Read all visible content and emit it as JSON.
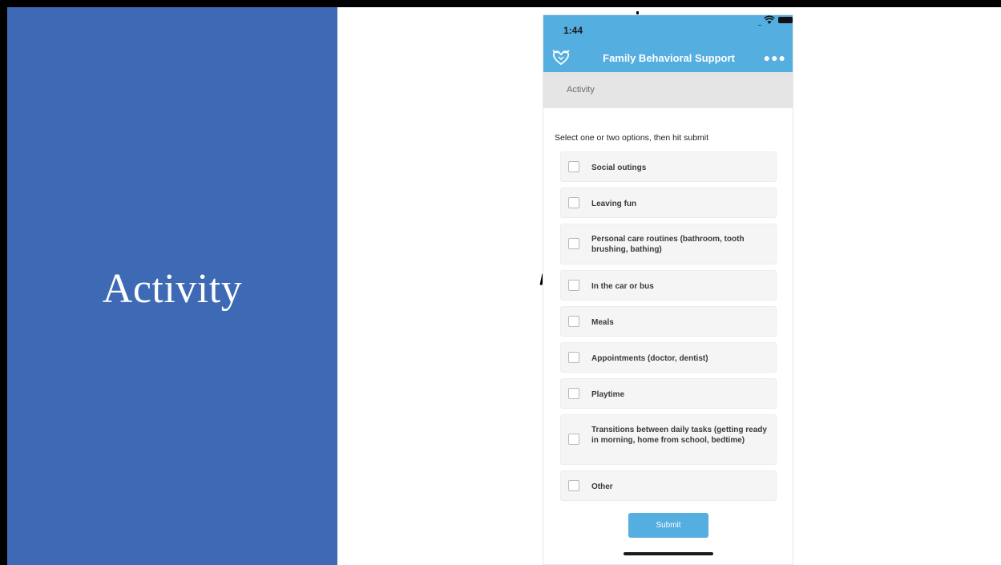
{
  "slide": {
    "title": "Activity"
  },
  "status_bar": {
    "time": "1:44"
  },
  "app": {
    "title": "Family Behavioral Support",
    "more_icon": "more-icon"
  },
  "section": {
    "label": "Activity"
  },
  "form": {
    "instructions": "Select one or two options, then hit submit",
    "options": [
      {
        "label": "Social outings",
        "checked": false
      },
      {
        "label": "Leaving fun",
        "checked": false
      },
      {
        "label": "Personal care routines (bathroom, tooth brushing, bathing)",
        "checked": false
      },
      {
        "label": "In the car or bus",
        "checked": false
      },
      {
        "label": "Meals",
        "checked": false
      },
      {
        "label": "Appointments (doctor, dentist)",
        "checked": false
      },
      {
        "label": "Playtime",
        "checked": false
      },
      {
        "label": "Transitions between daily tasks (getting ready in morning, home from school, bedtime)",
        "checked": false
      },
      {
        "label": "Other",
        "checked": false
      }
    ],
    "submit_label": "Submit"
  },
  "colors": {
    "slide_panel": "#3d69b5",
    "app_bar": "#55aee0",
    "section_header": "#e5e5e5"
  }
}
